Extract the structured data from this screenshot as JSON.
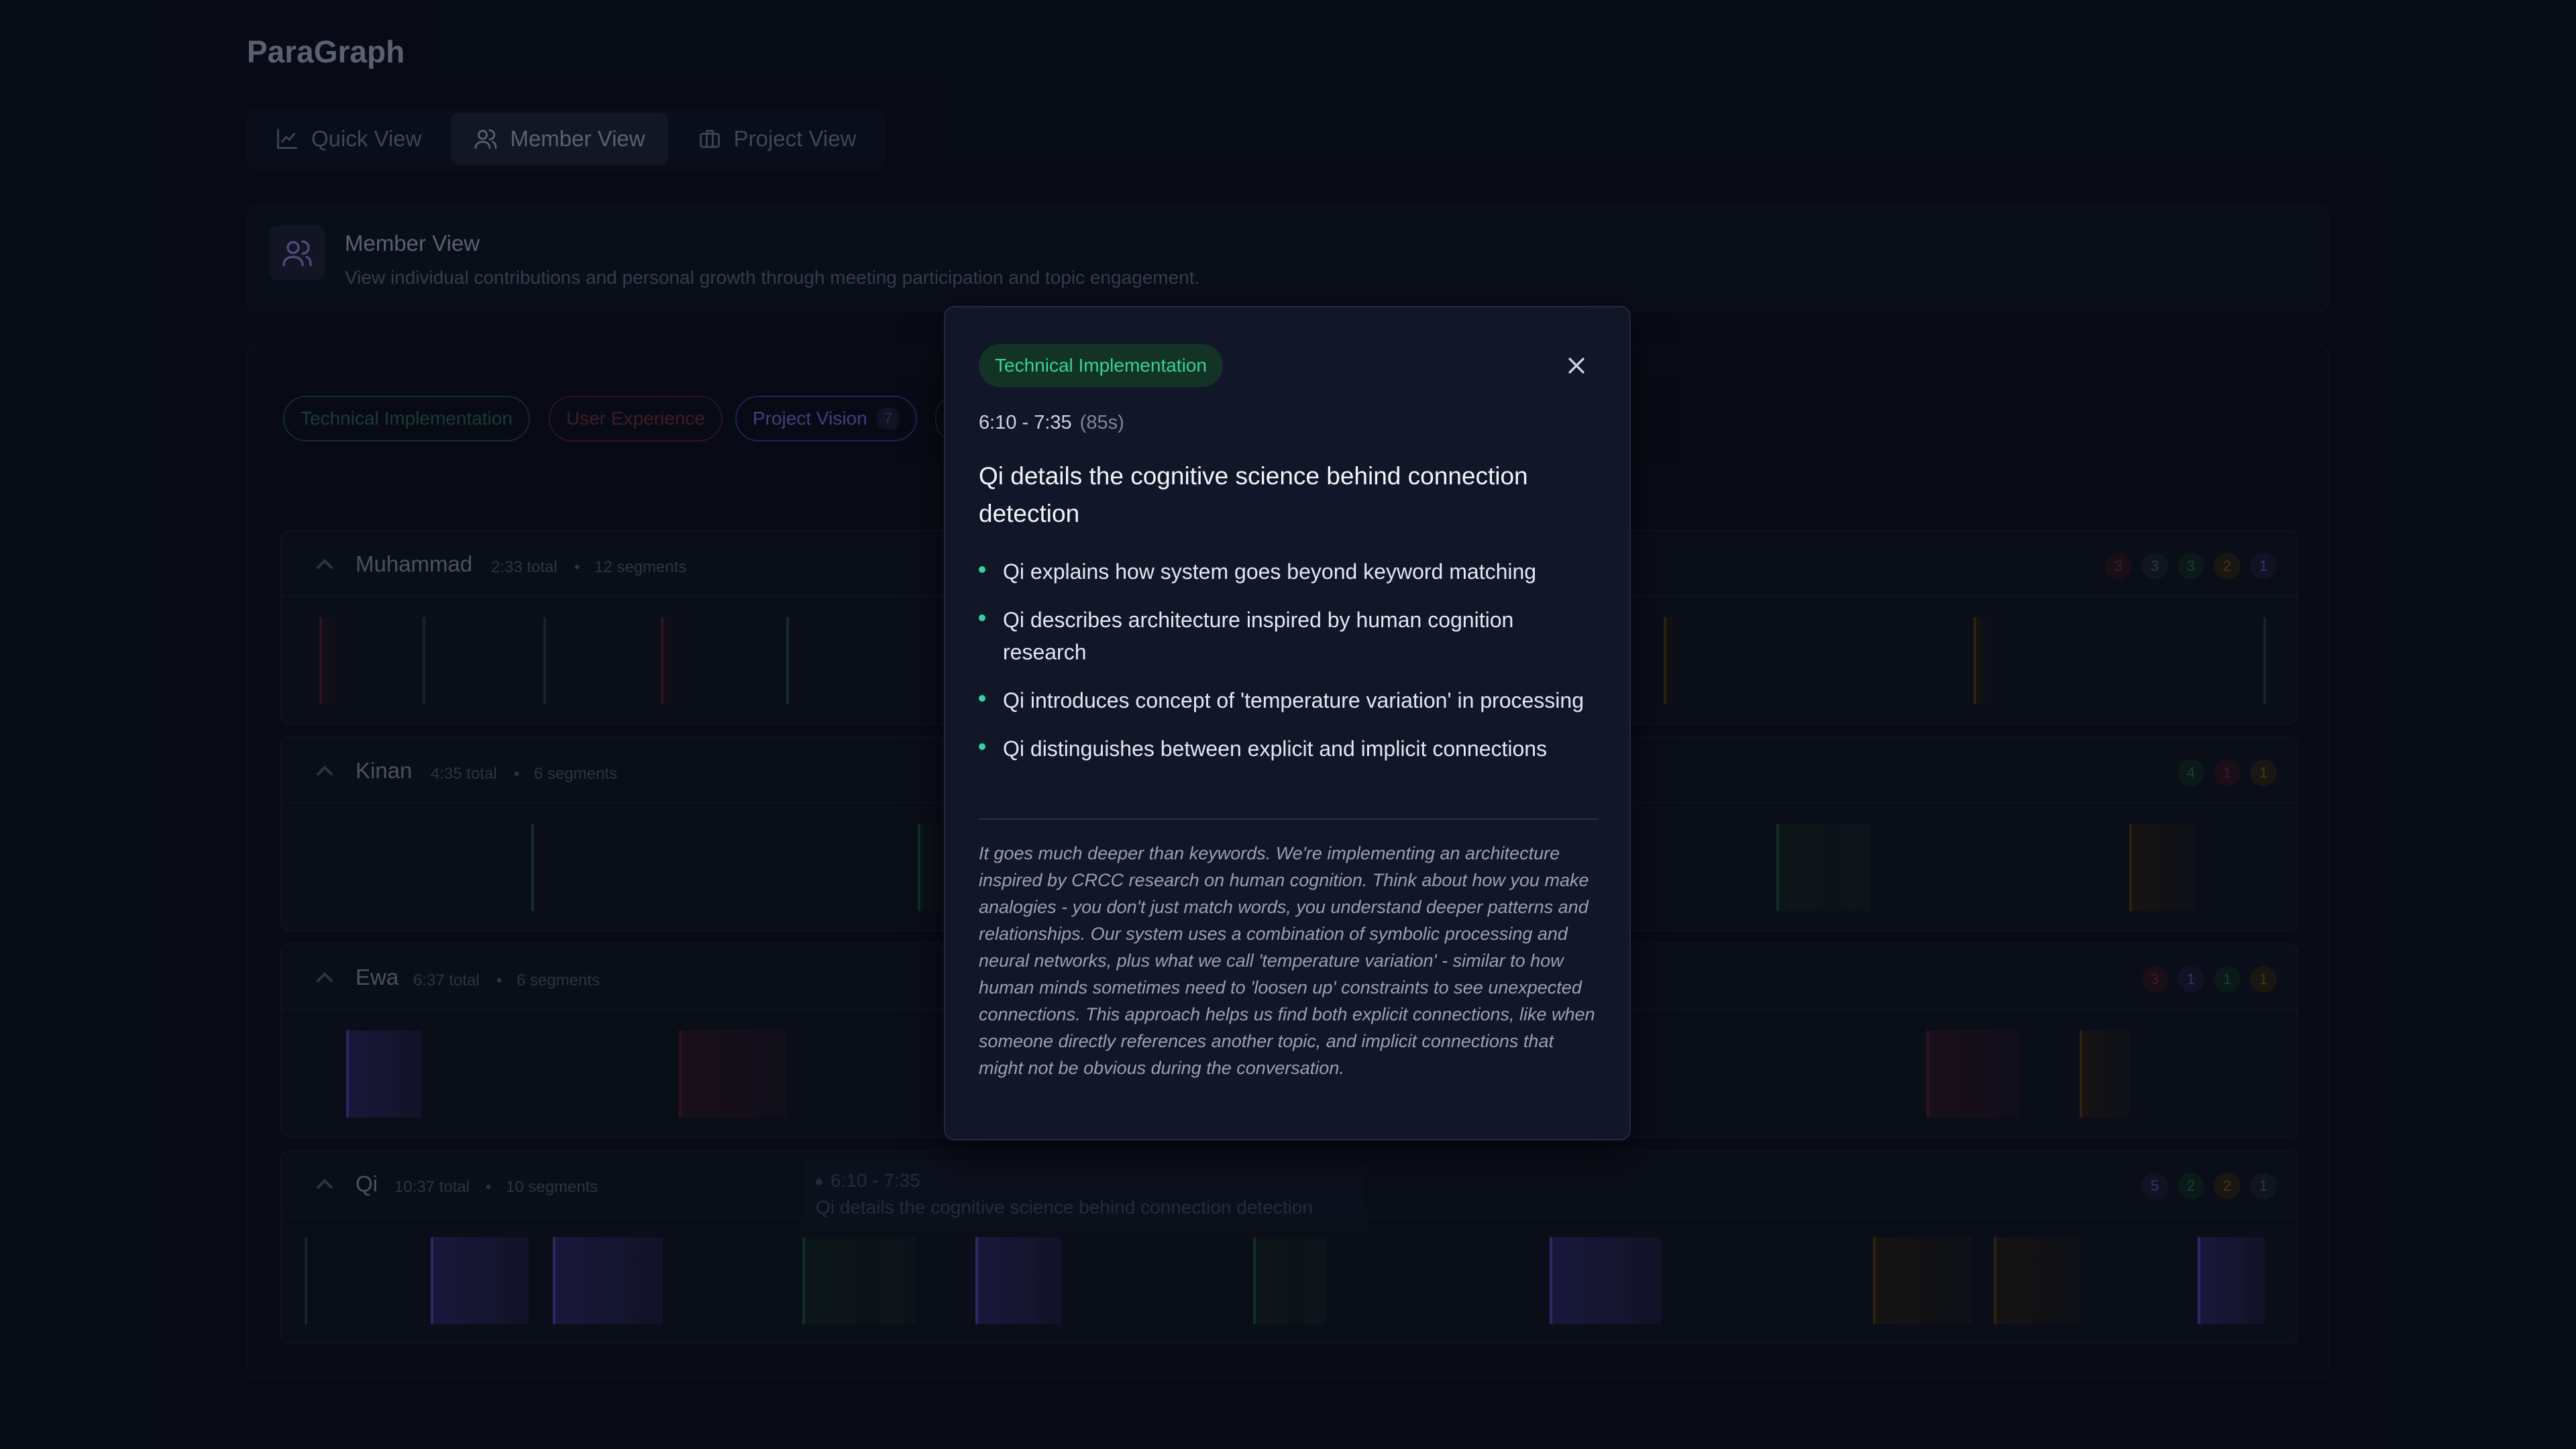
{
  "app": {
    "title": "ParaGraph"
  },
  "tabs": [
    {
      "label": "Quick View",
      "icon": "chart-line-icon",
      "active": false
    },
    {
      "label": "Member View",
      "icon": "users-icon",
      "active": true
    },
    {
      "label": "Project View",
      "icon": "briefcase-icon",
      "active": false
    }
  ],
  "header": {
    "icon": "users-icon",
    "title": "Member View",
    "subtitle": "View individual contributions and personal growth through meeting participation and topic engagement."
  },
  "filters": [
    {
      "label": "Technical Implementation",
      "color": "#1f5a45",
      "text_color": "#2a6b52",
      "count": ""
    },
    {
      "label": "User Experience",
      "color": "#5a2230",
      "text_color": "#6b2a3a",
      "count": ""
    },
    {
      "label": "Project Vision",
      "color": "#3f3a8a",
      "text_color": "#6f67c9",
      "count": "7"
    }
  ],
  "colors": {
    "tech": "#34d399",
    "ux": "#f43f5e",
    "vision": "#8b5cf6",
    "strategy": "#f59e0b",
    "neutral": "#64748b"
  },
  "members": [
    {
      "name": "Muhammad",
      "total": "2:33 total",
      "segments": "12 segments",
      "counts": [
        "3",
        "3",
        "3",
        "2",
        "1"
      ]
    },
    {
      "name": "Kinan",
      "total": "4:35 total",
      "segments": "6 segments",
      "counts": [
        "4",
        "1",
        "1"
      ]
    },
    {
      "name": "Ewa",
      "total": "6:37 total",
      "segments": "6 segments",
      "counts": [
        "3",
        "1",
        "1",
        "1"
      ]
    },
    {
      "name": "Qi",
      "total": "10:37 total",
      "segments": "10 segments",
      "counts": [
        "5",
        "2",
        "2",
        "1"
      ]
    }
  ],
  "hover": {
    "time": "6:10 - 7:35",
    "text": "Qi details the cognitive science behind connection detection"
  },
  "modal": {
    "badge": "Technical Implementation",
    "time": "6:10 - 7:35",
    "duration": "(85s)",
    "title": "Qi details the cognitive science behind connection detection",
    "bullets": [
      "Qi explains how system goes beyond keyword matching",
      "Qi describes architecture inspired by human cognition research",
      "Qi introduces concept of 'temperature variation' in processing",
      "Qi distinguishes between explicit and implicit connections"
    ],
    "quote": "It goes much deeper than keywords. We're implementing an architecture inspired by CRCC research on human cognition. Think about how you make analogies - you don't just match words, you understand deeper patterns and relationships. Our system uses a combination of symbolic processing and neural networks, plus what we call 'temperature variation' - similar to how human minds sometimes need to 'loosen up' constraints to see unexpected connections. This approach helps us find both explicit connections, like when someone directly references another topic, and implicit connections that might not be obvious during the conversation.",
    "close_icon": "close-icon"
  }
}
